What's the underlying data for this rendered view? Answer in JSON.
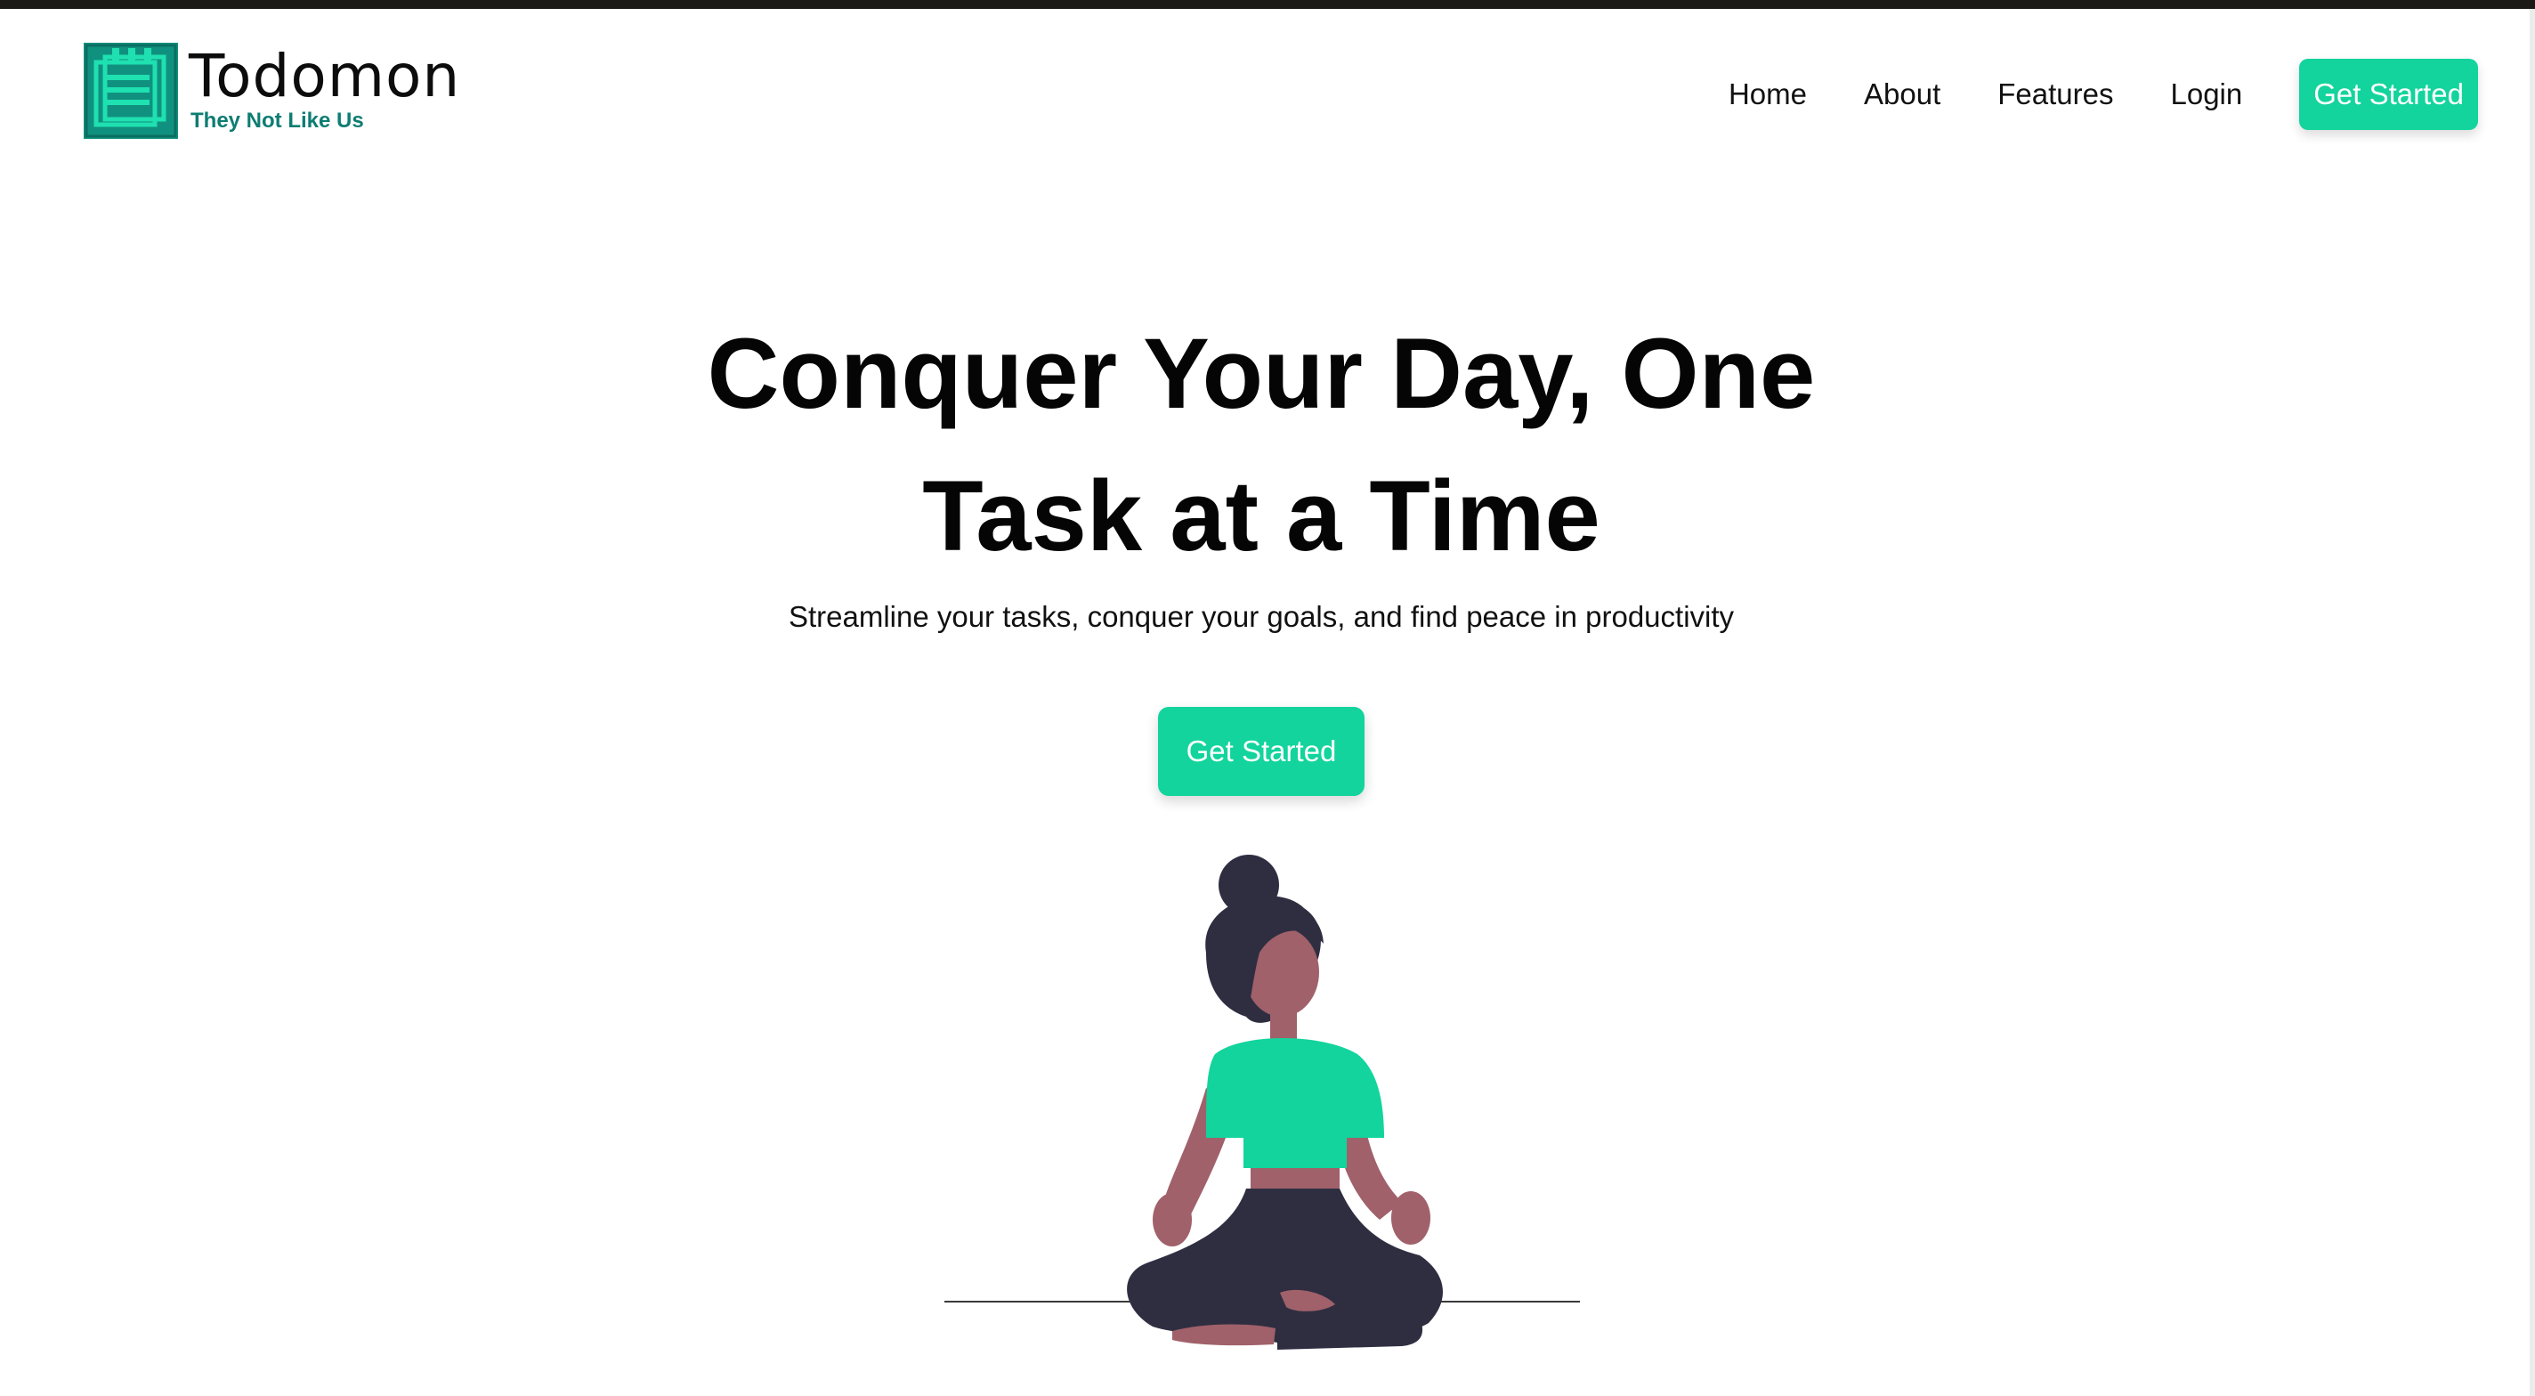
{
  "brand": {
    "name": "Todomon",
    "tagline": "They Not Like Us",
    "icon": "notepad-icon",
    "color": "#13a38d"
  },
  "nav": {
    "items": [
      {
        "label": "Home"
      },
      {
        "label": "About"
      },
      {
        "label": "Features"
      },
      {
        "label": "Login"
      }
    ],
    "cta_label": "Get Started"
  },
  "hero": {
    "title": "Conquer Your Day, One Task at a Time",
    "subtitle": "Streamline your tasks, conquer your goals, and find peace in productivity",
    "cta_label": "Get Started"
  },
  "colors": {
    "accent": "#12d49c",
    "skin": "#a0616a",
    "dark": "#2f2e41"
  }
}
